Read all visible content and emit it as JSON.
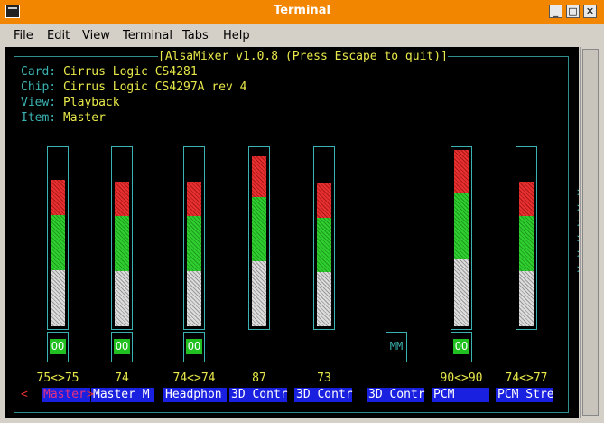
{
  "window": {
    "title": "Terminal"
  },
  "menu": [
    "File",
    "Edit",
    "View",
    "Terminal",
    "Tabs",
    "Help"
  ],
  "mixer": {
    "header": "[AlsaMixer v1.0.8 (Press Escape to quit)]",
    "info": [
      {
        "key": "Card:",
        "value": "Cirrus Logic CS4281"
      },
      {
        "key": "Chip:",
        "value": "Cirrus Logic CS4297A rev 4"
      },
      {
        "key": "View:",
        "value": "Playback"
      },
      {
        "key": "Item:",
        "value": "Master"
      }
    ],
    "controls": [
      {
        "name": "Master",
        "value": "75<>75",
        "level": 0.75,
        "mute": "OO"
      },
      {
        "name": "Master M",
        "value": "74",
        "level": 0.74,
        "mute": "OO"
      },
      {
        "name": "Headphon",
        "value": "74<>74",
        "level": 0.74,
        "mute": "OO"
      },
      {
        "name": "3D Contr",
        "value": "87",
        "level": 0.87,
        "mute": ""
      },
      {
        "name": "3D Contr",
        "value": "73",
        "level": 0.73,
        "mute": ""
      },
      {
        "name": "3D Contr",
        "value": "",
        "level": null,
        "mute": "MM"
      },
      {
        "name": "PCM",
        "value": "90<>90",
        "level": 0.9,
        "mute": "OO"
      },
      {
        "name": "PCM Stre",
        "value": "74<>77",
        "level": 0.74,
        "mute": ""
      }
    ],
    "nav_left": "<",
    "nav_sel": ">",
    "more_right": ">"
  },
  "colors": {
    "title_bar": "#f28600",
    "label_bg": "#1a20e0",
    "accent_cyan": "#3bb3b3",
    "text_yellow": "#e8e84a"
  }
}
